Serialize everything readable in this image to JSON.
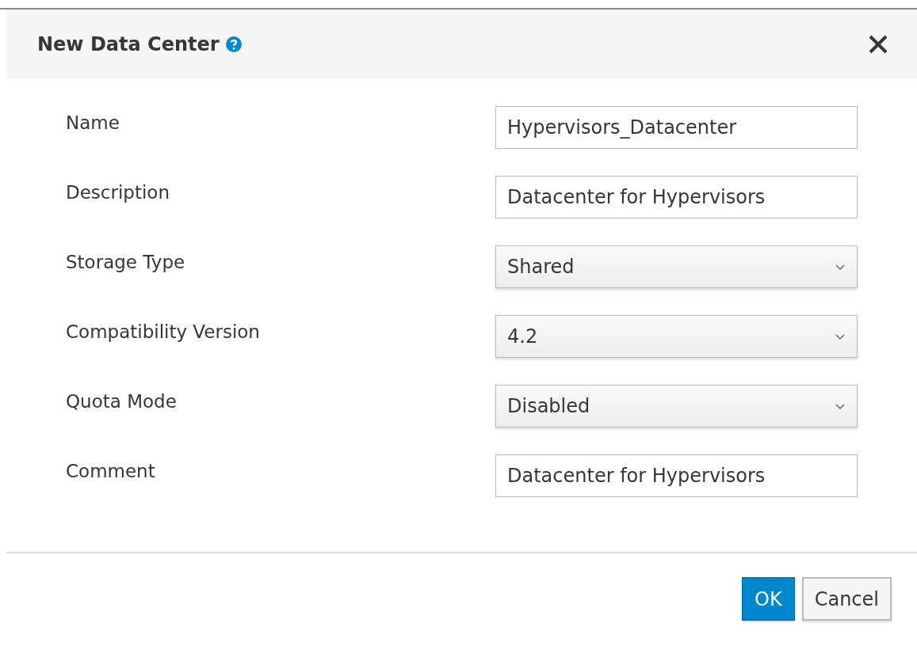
{
  "dialog": {
    "title": "New Data Center"
  },
  "fields": [
    {
      "label": "Name",
      "kind": "text",
      "value": "Hypervisors_Datacenter"
    },
    {
      "label": "Description",
      "kind": "text",
      "value": "Datacenter for Hypervisors"
    },
    {
      "label": "Storage Type",
      "kind": "select",
      "value": "Shared"
    },
    {
      "label": "Compatibility Version",
      "kind": "select",
      "value": "4.2"
    },
    {
      "label": "Quota Mode",
      "kind": "select",
      "value": "Disabled"
    },
    {
      "label": "Comment",
      "kind": "text",
      "value": "Datacenter for Hypervisors"
    }
  ],
  "buttons": [
    {
      "label": "OK",
      "kind": "primary"
    },
    {
      "label": "Cancel",
      "kind": "default"
    }
  ]
}
